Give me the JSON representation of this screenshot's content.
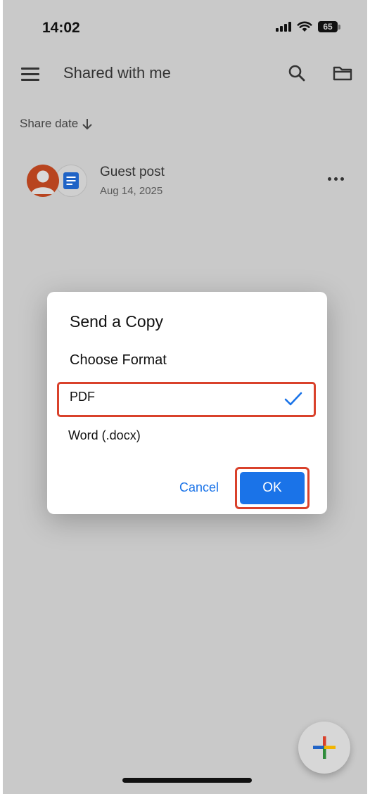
{
  "status_bar": {
    "time": "14:02",
    "battery": "65",
    "icons": [
      "signal-icon",
      "wifi-icon",
      "battery-icon"
    ]
  },
  "app_bar": {
    "title": "Shared with me",
    "icons": [
      "menu-icon",
      "search-icon",
      "folder-icon"
    ]
  },
  "sort": {
    "label": "Share date",
    "direction_icon": "arrow-down-icon"
  },
  "files": [
    {
      "name": "Guest post",
      "date": "Aug 14, 2025",
      "icons": [
        "person-avatar-icon",
        "google-docs-icon",
        "more-horizontal-icon"
      ]
    }
  ],
  "dialog": {
    "title": "Send a Copy",
    "subtitle": "Choose Format",
    "options": [
      {
        "label": "PDF",
        "selected": true
      },
      {
        "label": "Word (.docx)",
        "selected": false
      }
    ],
    "cancel_label": "Cancel",
    "ok_label": "OK"
  },
  "fab": {
    "icon": "plus-icon"
  },
  "colors": {
    "accent": "#1a73e8",
    "highlight": "#d9412b",
    "scrim": "#c9c9c9",
    "avatar": "#b8441f",
    "docs_blue": "#1f63c6"
  }
}
